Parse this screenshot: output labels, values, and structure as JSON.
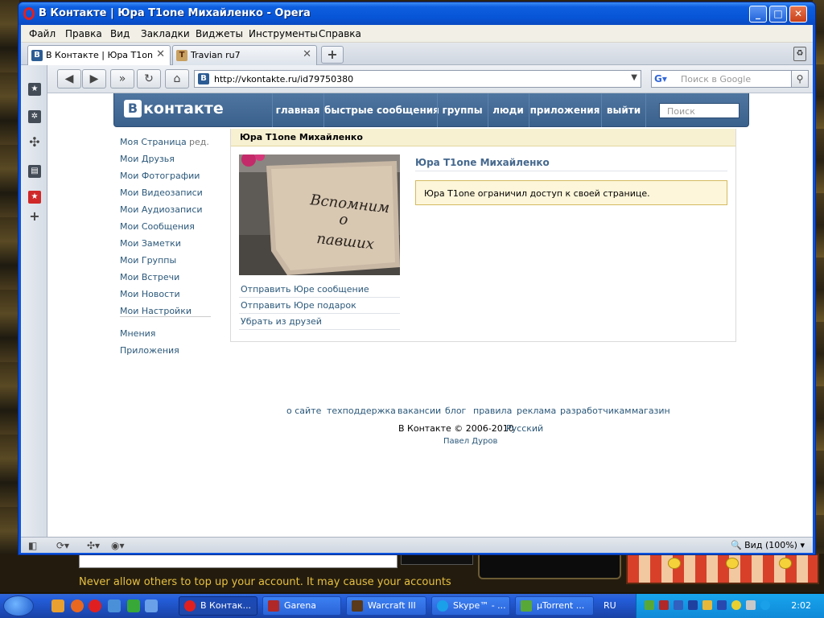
{
  "window": {
    "title": "В Контакте | Юра T1one Михайленко - Opera"
  },
  "menu": [
    "Файл",
    "Правка",
    "Вид",
    "Закладки",
    "Виджеты",
    "Инструменты",
    "Справка"
  ],
  "tabs": [
    {
      "label": "В Контакте | Юра T1on...",
      "close": "✕"
    },
    {
      "label": "Travian ru7",
      "close": "✕"
    }
  ],
  "address": {
    "url": "http://vkontakte.ru/id79750380"
  },
  "search": {
    "placeholder": "Поиск в Google"
  },
  "status": {
    "zoom": "Вид (100%)"
  },
  "vk": {
    "logo": "контакте",
    "logo_letter": "В",
    "nav": [
      "главная",
      "быстрые сообщения",
      "группы",
      "люди",
      "приложения",
      "выйти"
    ],
    "search_placeholder": "Поиск",
    "left_menu": [
      "Моя Страница",
      "Мои Друзья",
      "Мои Фотографии",
      "Мои Видеозаписи",
      "Мои Аудиозаписи",
      "Мои Сообщения",
      "Мои Заметки",
      "Мои Группы",
      "Мои Встречи",
      "Мои Новости",
      "Мои Настройки"
    ],
    "left_menu_edit": "ред.",
    "left_menu_extra": [
      "Мнения",
      "Приложения"
    ],
    "profile": {
      "header": "Юра T1one Михайленко",
      "name": "Юра T1one Михайленко",
      "notice": "Юра T1one ограничил доступ к своей странице.",
      "photo_text": [
        "Вспомним",
        "о",
        "павших"
      ],
      "actions": [
        "Отправить Юре сообщение",
        "Отправить Юре подарок",
        "Убрать из друзей"
      ]
    },
    "footer": {
      "links": [
        "о сайте",
        "техподдержка",
        "вакансии",
        "блог",
        "правила",
        "реклама",
        "разработчикам",
        "магазин"
      ],
      "copyright": "В Контакте © 2006-2010",
      "language": "Русский",
      "author": "Павел Дуров"
    }
  },
  "desktop": {
    "warning": "Never allow others to top up your account. It may cause your accounts"
  },
  "taskbar": {
    "items": [
      "В Контак...",
      "Garena",
      "Warcraft III",
      "Skype™ - ...",
      "µTorrent ..."
    ],
    "lang": "RU",
    "clock": "2:02"
  }
}
